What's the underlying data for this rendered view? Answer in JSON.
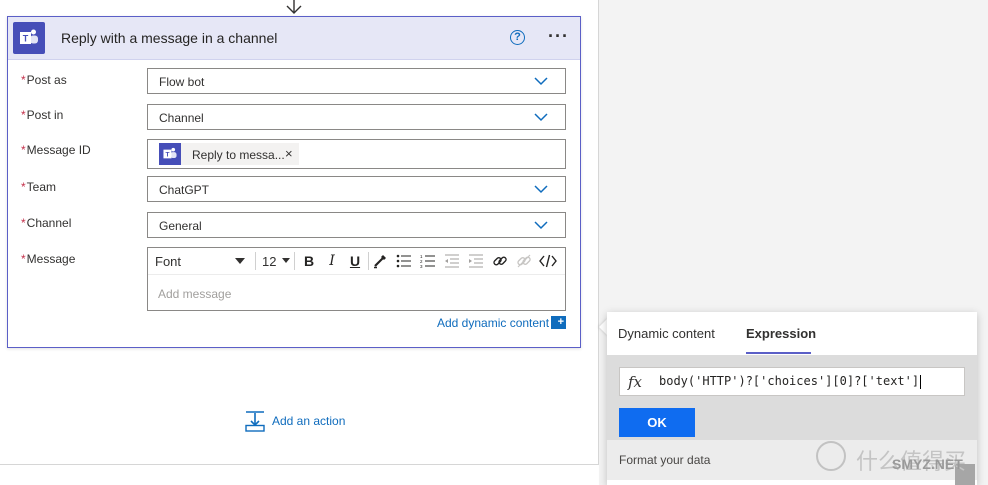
{
  "card": {
    "title": "Reply with a message in a channel",
    "help": "?",
    "more": "···"
  },
  "fields": {
    "post_as": {
      "label": "Post as",
      "value": "Flow bot"
    },
    "post_in": {
      "label": "Post in",
      "value": "Channel"
    },
    "message_id": {
      "label": "Message ID",
      "token": "Reply to messa...",
      "token_close": "×"
    },
    "team": {
      "label": "Team",
      "value": "ChatGPT"
    },
    "channel": {
      "label": "Channel",
      "value": "General"
    },
    "message": {
      "label": "Message",
      "placeholder": "Add message"
    }
  },
  "required_marker": "*",
  "toolbar": {
    "font": "Font",
    "size": "12",
    "bold": "B",
    "italic": "I",
    "underline": "U"
  },
  "dynamic_content_link": "Add dynamic content",
  "dynamic_content_plus": "+",
  "add_action": "Add an action",
  "popup": {
    "tabs": [
      "Dynamic content",
      "Expression"
    ],
    "active_tab": "Expression",
    "fx": "fx",
    "expression": "body('HTTP')?['choices'][0]?['text']",
    "ok_label": "OK",
    "format_label": "Format your data"
  },
  "watermark": {
    "text": "什么值得买",
    "sub": "SMYZ.NET"
  },
  "colors": {
    "accent": "#5b5fc7",
    "link": "#0f6cbd",
    "ok_button": "#0f6cf0",
    "required": "#c4314b",
    "teams_purple": "#464eb8"
  }
}
